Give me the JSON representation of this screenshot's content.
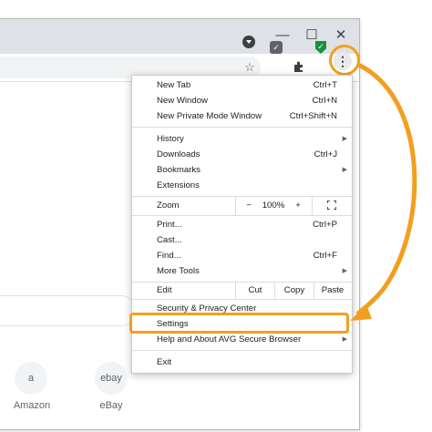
{
  "colors": {
    "accent_orange": "#f29f1f",
    "ext_green": "#1e8e3e"
  },
  "window_controls": {
    "minimize": "—",
    "maximize": "☐",
    "close": "✕"
  },
  "toolbar": {
    "bookmark_icon": "☆",
    "extensions_icon": "puzzle-icon",
    "menu_icon": "⋮"
  },
  "menu": {
    "new_tab": {
      "label": "New Tab",
      "shortcut": "Ctrl+T"
    },
    "new_window": {
      "label": "New Window",
      "shortcut": "Ctrl+N"
    },
    "new_private": {
      "label": "New Private Mode Window",
      "shortcut": "Ctrl+Shift+N"
    },
    "history": {
      "label": "History"
    },
    "downloads": {
      "label": "Downloads",
      "shortcut": "Ctrl+J"
    },
    "bookmarks": {
      "label": "Bookmarks"
    },
    "extensions": {
      "label": "Extensions"
    },
    "zoom": {
      "label": "Zoom",
      "minus": "−",
      "value": "100%",
      "plus": "+"
    },
    "print": {
      "label": "Print...",
      "shortcut": "Ctrl+P"
    },
    "cast": {
      "label": "Cast..."
    },
    "find": {
      "label": "Find...",
      "shortcut": "Ctrl+F"
    },
    "more_tools": {
      "label": "More Tools"
    },
    "edit": {
      "label": "Edit",
      "cut": "Cut",
      "copy": "Copy",
      "paste": "Paste"
    },
    "security": {
      "label": "Security & Privacy Center"
    },
    "settings": {
      "label": "Settings"
    },
    "help": {
      "label": "Help and About AVG Secure Browser"
    },
    "exit": {
      "label": "Exit"
    }
  },
  "shortcuts": [
    {
      "label": "Amazon",
      "icon": "a"
    },
    {
      "label": "eBay",
      "icon": "ebay"
    }
  ]
}
